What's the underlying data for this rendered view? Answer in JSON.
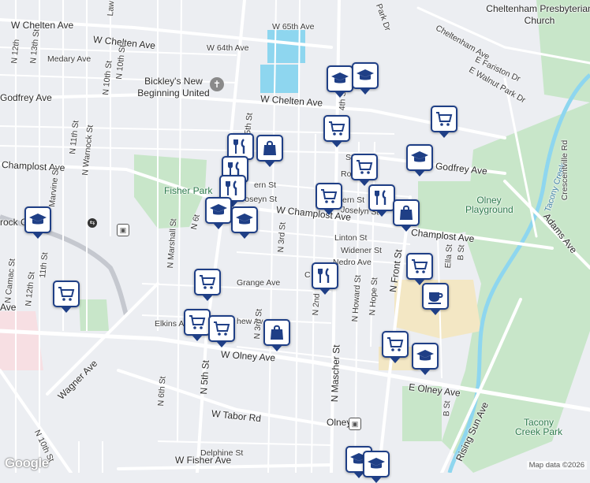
{
  "map": {
    "attribution": "Map data ©2026",
    "logo_text": "Google",
    "labels": {
      "w_chelten_ave_left": "W Chelten Ave",
      "w_chelten_ave_mid": "W Chelten Ave",
      "w_65th_ave": "W 65th Ave",
      "w_64th_ave": "W 64th Ave",
      "medary_ave": "Medary Ave",
      "godfrey_ave_left": "Godfrey Ave",
      "godfrey_ave_right": "Godfrey Ave",
      "champlost_ave_left": "Champlost Ave",
      "w_champlost_ave": "W Champlost Ave",
      "champlost_ave_right": "Champlost Ave",
      "fisher_park": "Fisher Park",
      "olney_playground": "Olney Playground",
      "tacony_creek_park": "Tacony Creek Park",
      "tacony_creek": "Tacony Creek",
      "adams_ave": "Adams Ave",
      "crescentville_rd": "Crescentville Rd",
      "cheltenham_presbyterian": "Cheltenham Presbyterian Church",
      "bickleys": "Bickley's New Beginning United",
      "rock_center": "rock Center",
      "linton_st": "Linton St",
      "widener_st": "Widener St",
      "grange_ave": "Grange Ave",
      "elkins_ave": "Elkins Av",
      "w_olney_ave": "W Olney Ave",
      "e_olney_ave": "E Olney Ave",
      "w_tabor_rd": "W Tabor Rd",
      "wagner_ave": "Wagner Ave",
      "delphine_st": "Delphine St",
      "w_fisher_ave": "W Fisher Ave",
      "olney_station": "Olney",
      "n_mascher_st": "N Mascher St",
      "n_front_st": "N Front St",
      "n_5th_st": "N 5th St",
      "n_6th_st": "N 6th St",
      "n_3rd_st": "N 3rd St",
      "n_2nd_st": "N 2nd",
      "n_marshall_st": "N Marshall St",
      "n_10th_st": "N 10th St",
      "n_11th_st": "N 11th St",
      "n_12th_st": "N 12th St",
      "n_13th_st": "N 13th St",
      "n_warnock_st": "N Warnock St",
      "marvine_st": "Marvine St",
      "n_camac_st": "N Camac St",
      "n_howard_st": "N Howard St",
      "n_hope_st": "N Hope St",
      "rising_sun_ave": "Rising Sun Ave",
      "e_fariston_dr": "E Fariston Dr",
      "e_walnut_park_dr": "E Walnut Park Dr",
      "cheltenham_ave": "Cheltenham Ave",
      "park_dr": "Park Dr",
      "ella_st": "Ella St",
      "b_st": "B St",
      "b_st_lower": "B St",
      "joseyn_st": "Joseyn St",
      "josselyn_st_right": "Joselyn St",
      "fern_st": "ern St",
      "fern_st_right": "ern St",
      "ro_st": "Ro",
      "st_label": "St",
      "nedro_ave": "Nedro Ave",
      "mathew_av": "hew Av",
      "lawn": "Law",
      "n6th_short": "N 6t",
      "n5th_top": "5th St",
      "n_3rd_st_top": "N 3rd St",
      "n_13th_st_lower": "N 13th St",
      "n11th_mid": "11th St",
      "n_10th_st_lower": "N 10th St",
      "n5th_lower": "5th St",
      "n3rd_lower": "N 3rd St",
      "n_2nd_lower": "N 2nd St",
      "ave_left": "Ave",
      "c_label": "C",
      "n_4th_label": "4th St",
      "n_12th_top": "N 12th",
      "n_11th_top": "N 11th St"
    },
    "markers": [
      {
        "type": "education",
        "icon": "education-icon"
      },
      {
        "type": "education",
        "icon": "education-icon"
      },
      {
        "type": "grocery",
        "icon": "grocery-cart-icon"
      },
      {
        "type": "grocery",
        "icon": "grocery-cart-icon"
      },
      {
        "type": "restaurant",
        "icon": "restaurant-icon"
      },
      {
        "type": "shopping",
        "icon": "shopping-bag-icon"
      },
      {
        "type": "education",
        "icon": "education-icon"
      },
      {
        "type": "grocery",
        "icon": "grocery-cart-icon"
      },
      {
        "type": "restaurant",
        "icon": "restaurant-icon"
      },
      {
        "type": "restaurant",
        "icon": "restaurant-icon"
      },
      {
        "type": "grocery",
        "icon": "grocery-cart-icon"
      },
      {
        "type": "restaurant",
        "icon": "restaurant-icon"
      },
      {
        "type": "education",
        "icon": "education-icon"
      },
      {
        "type": "education",
        "icon": "education-icon"
      },
      {
        "type": "shopping",
        "icon": "shopping-bag-icon"
      },
      {
        "type": "education",
        "icon": "education-icon"
      },
      {
        "type": "grocery",
        "icon": "grocery-cart-icon"
      },
      {
        "type": "restaurant",
        "icon": "restaurant-icon"
      },
      {
        "type": "grocery",
        "icon": "grocery-cart-icon"
      },
      {
        "type": "cafe",
        "icon": "coffee-cup-icon"
      },
      {
        "type": "grocery",
        "icon": "grocery-cart-icon"
      },
      {
        "type": "grocery",
        "icon": "grocery-cart-icon"
      },
      {
        "type": "grocery",
        "icon": "grocery-cart-icon"
      },
      {
        "type": "shopping",
        "icon": "shopping-bag-icon"
      },
      {
        "type": "grocery",
        "icon": "grocery-cart-icon"
      },
      {
        "type": "education",
        "icon": "education-icon"
      },
      {
        "type": "education",
        "icon": "education-icon"
      },
      {
        "type": "education",
        "icon": "education-icon"
      }
    ]
  }
}
